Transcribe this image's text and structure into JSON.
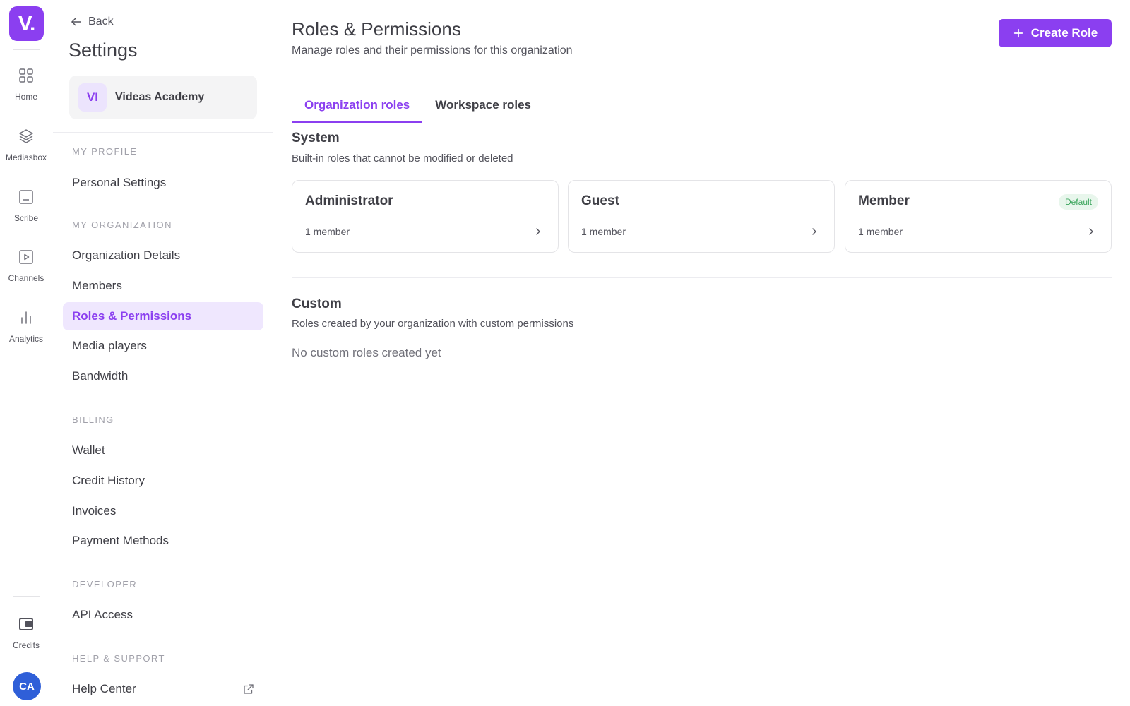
{
  "rail": {
    "logo": "V.",
    "items": [
      {
        "label": "Home",
        "icon": "grid-icon"
      },
      {
        "label": "Mediasbox",
        "icon": "layers-icon"
      },
      {
        "label": "Scribe",
        "icon": "scribe-icon"
      },
      {
        "label": "Channels",
        "icon": "play-square-icon"
      },
      {
        "label": "Analytics",
        "icon": "bar-chart-icon"
      }
    ],
    "credits_label": "Credits",
    "avatar_initials": "CA"
  },
  "sidebar": {
    "back_label": "Back",
    "title": "Settings",
    "org": {
      "initials": "VI",
      "name": "Videas Academy"
    },
    "sections": {
      "my_profile": "MY PROFILE",
      "my_organization": "MY ORGANIZATION",
      "billing": "BILLING",
      "developer": "DEVELOPER",
      "help_support": "HELP & SUPPORT"
    },
    "items": {
      "personal_settings": "Personal Settings",
      "organization_details": "Organization Details",
      "members": "Members",
      "roles_permissions": "Roles & Permissions",
      "media_players": "Media players",
      "bandwidth": "Bandwidth",
      "wallet": "Wallet",
      "credit_history": "Credit History",
      "invoices": "Invoices",
      "payment_methods": "Payment Methods",
      "api_access": "API Access",
      "help_center": "Help Center"
    },
    "active_item": "Roles & Permissions"
  },
  "main": {
    "title": "Roles & Permissions",
    "subtitle": "Manage roles and their permissions for this organization",
    "create_button": "Create Role",
    "tabs": [
      {
        "label": "Organization roles",
        "active": true
      },
      {
        "label": "Workspace roles",
        "active": false
      }
    ],
    "system": {
      "title": "System",
      "description": "Built-in roles that cannot be modified or deleted",
      "roles": [
        {
          "name": "Administrator",
          "count": "1 member",
          "badge": ""
        },
        {
          "name": "Guest",
          "count": "1 member",
          "badge": ""
        },
        {
          "name": "Member",
          "count": "1 member",
          "badge": "Default"
        }
      ]
    },
    "custom": {
      "title": "Custom",
      "description": "Roles created by your organization with custom permissions",
      "empty_text": "No custom roles created yet"
    }
  },
  "colors": {
    "accent": "#8b3ff0",
    "accent_soft": "#efe7fe",
    "default_badge_bg": "#e8f6ec",
    "default_badge_text": "#3ba55c",
    "avatar": "#2f5fd8"
  }
}
